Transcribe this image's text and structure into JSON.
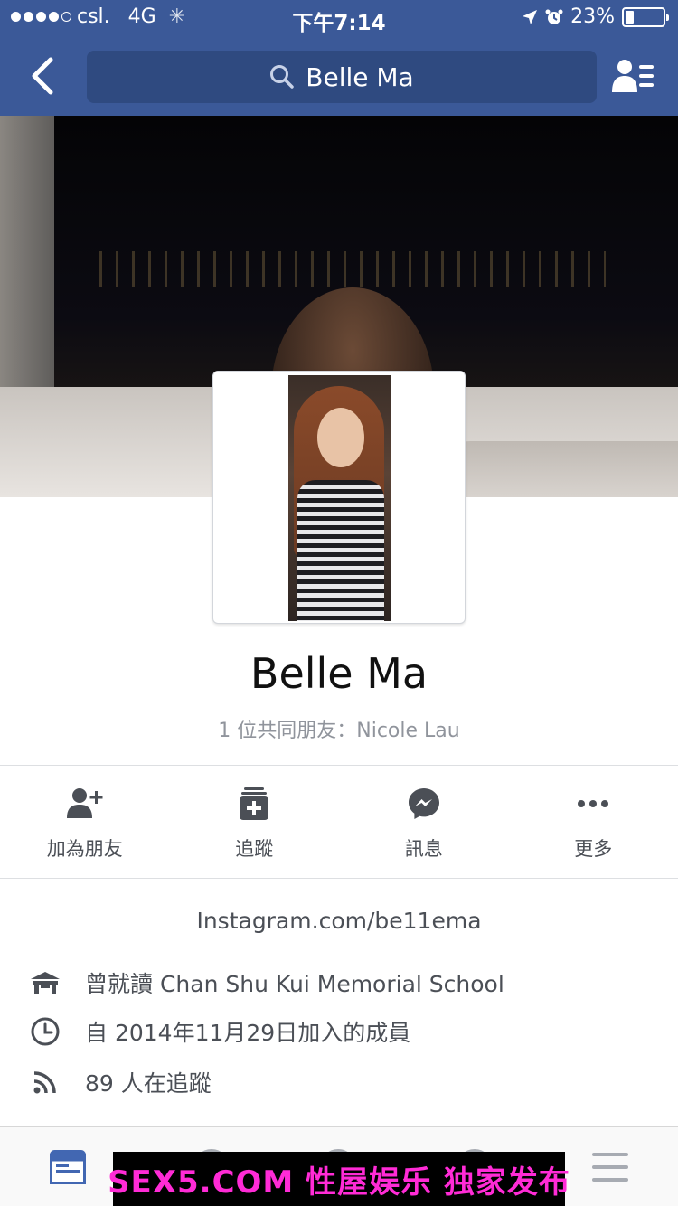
{
  "status_bar": {
    "carrier": "csl.",
    "network": "4G",
    "time": "下午7:14",
    "battery": "23%",
    "battery_level": 0.23
  },
  "nav": {
    "search_text": "Belle Ma",
    "back_icon": "chevron-left-icon",
    "search_icon": "search-icon",
    "profile_icon": "person-list-icon"
  },
  "profile": {
    "name": "Belle Ma",
    "mutual_friends": "1 位共同朋友：Nicole Lau"
  },
  "actions": [
    {
      "label": "加為朋友",
      "icon": "add-friend-icon"
    },
    {
      "label": "追蹤",
      "icon": "follow-icon"
    },
    {
      "label": "訊息",
      "icon": "messenger-icon"
    },
    {
      "label": "更多",
      "icon": "more-icon"
    }
  ],
  "intro": {
    "link": "Instagram.com/be11ema",
    "items": [
      {
        "text": "曾就讀 Chan Shu Kui Memorial School",
        "icon": "school-icon"
      },
      {
        "text": "自 2014年11月29日加入的成員",
        "icon": "clock-icon"
      },
      {
        "text": "89 人在追蹤",
        "icon": "rss-icon"
      }
    ]
  },
  "watermark": "SEX5.COM 性屋娱乐 独家发布",
  "colors": {
    "brand": "#3b5998",
    "active_tab": "#4267b2",
    "watermark_text": "#ff2bd6"
  }
}
